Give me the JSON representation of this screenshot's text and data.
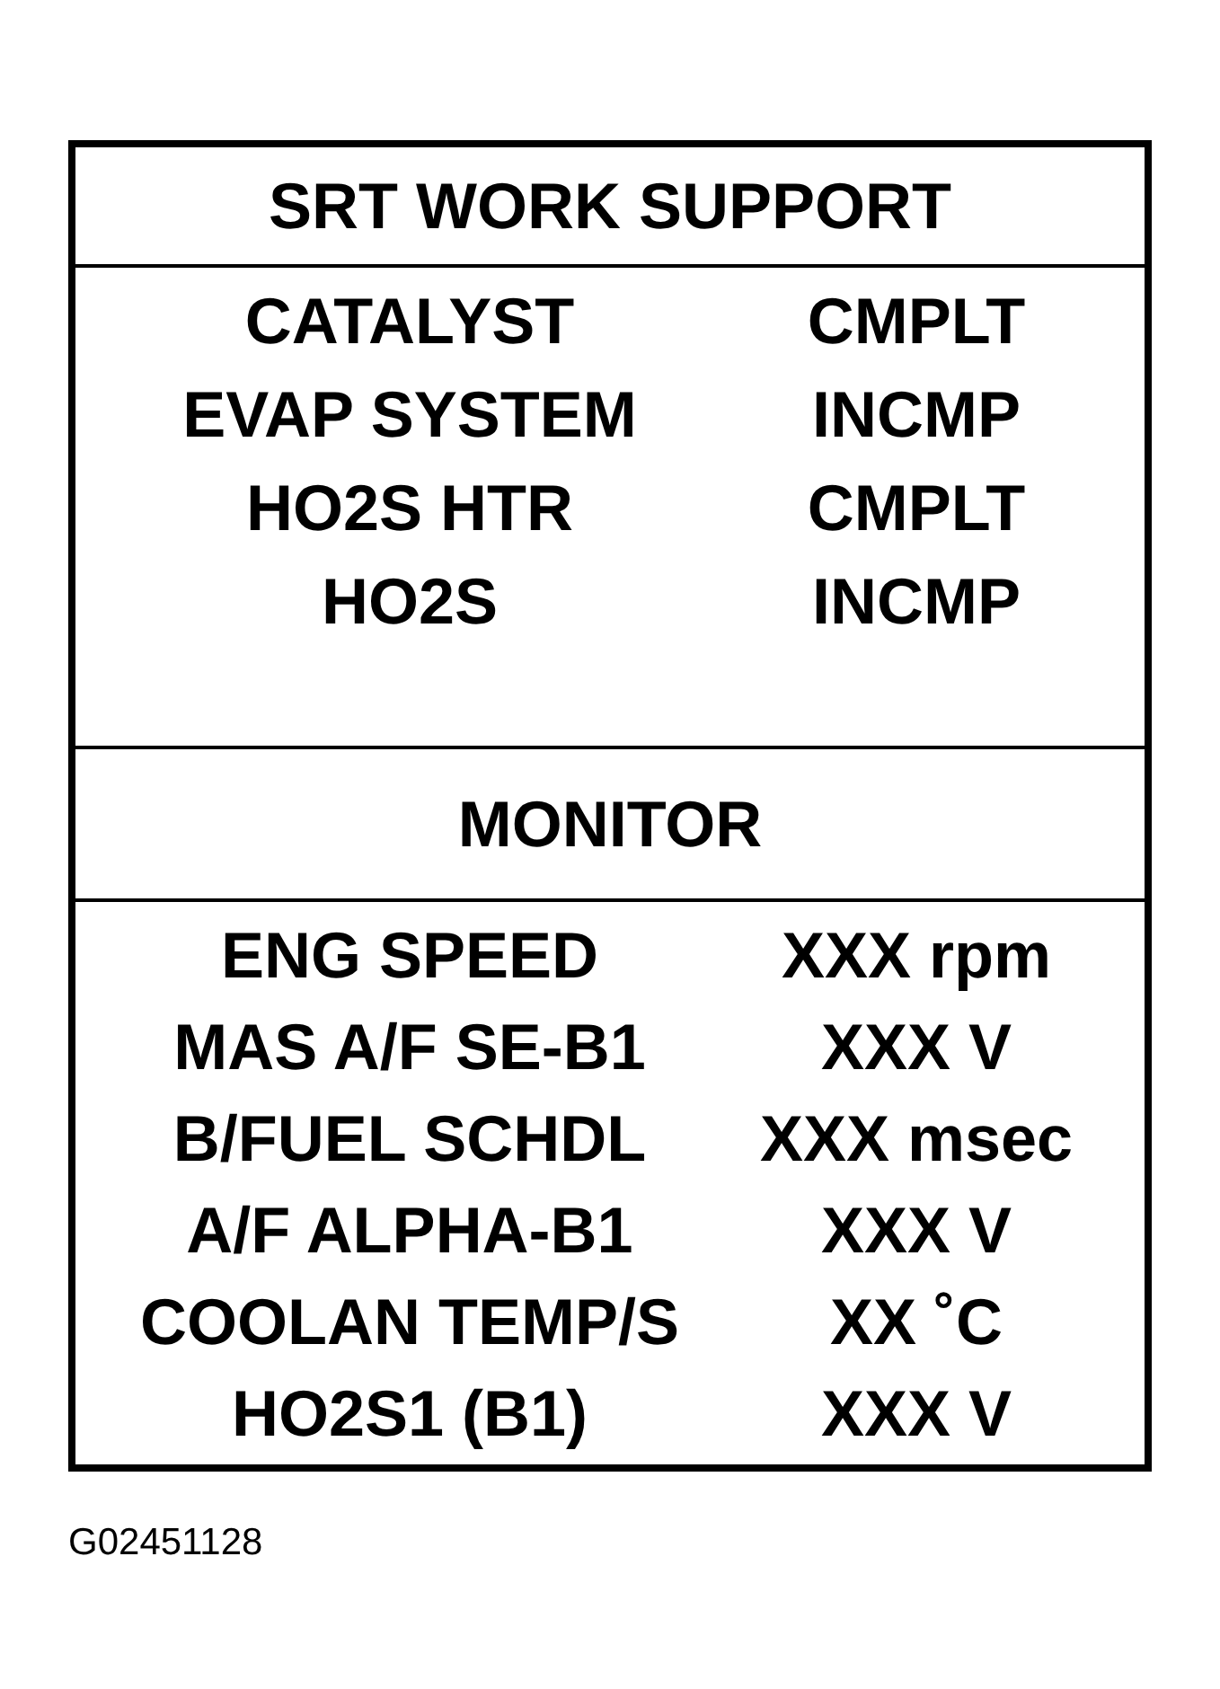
{
  "title": "SRT WORK SUPPORT",
  "work_support": [
    {
      "item": "CATALYST",
      "status": "CMPLT"
    },
    {
      "item": "EVAP SYSTEM",
      "status": "INCMP"
    },
    {
      "item": "HO2S HTR",
      "status": "CMPLT"
    },
    {
      "item": "HO2S",
      "status": "INCMP"
    }
  ],
  "monitor": {
    "title": "MONITOR",
    "rows": [
      {
        "item": "ENG SPEED",
        "value": "XXX rpm"
      },
      {
        "item": "MAS A/F SE-B1",
        "value": "XXX V"
      },
      {
        "item": "B/FUEL SCHDL",
        "value": "XXX msec"
      },
      {
        "item": "A/F ALPHA-B1",
        "value": "XXX V"
      },
      {
        "item": "COOLAN TEMP/S",
        "value": "XX ˚C"
      },
      {
        "item": "HO2S1 (B1)",
        "value": "XXX V"
      }
    ]
  },
  "figure_id": "G02451128"
}
